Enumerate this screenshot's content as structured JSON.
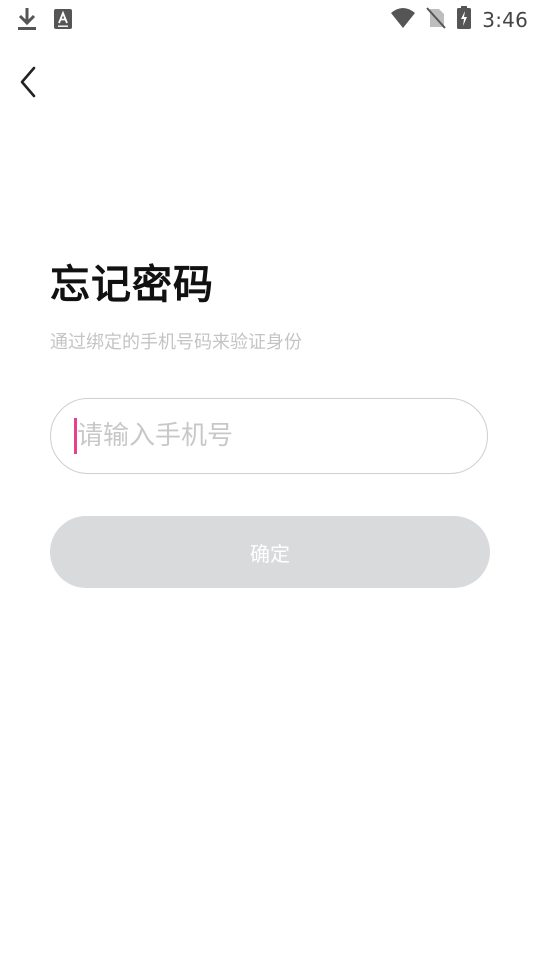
{
  "status_bar": {
    "time": "3:46",
    "left_icons": [
      "download-icon",
      "keyboard-a-icon"
    ],
    "right_icons": [
      "wifi-icon",
      "no-sim-icon",
      "battery-charging-icon"
    ]
  },
  "header": {
    "back_icon": "chevron-left-icon"
  },
  "main": {
    "title": "忘记密码",
    "subtitle": "通过绑定的手机号码来验证身份",
    "phone_input": {
      "placeholder": "请输入手机号",
      "value": ""
    },
    "confirm_label": "确定"
  },
  "colors": {
    "caret": "#e8408a",
    "button_disabled": "#d9dadc",
    "subtitle": "#c4c4c4"
  }
}
